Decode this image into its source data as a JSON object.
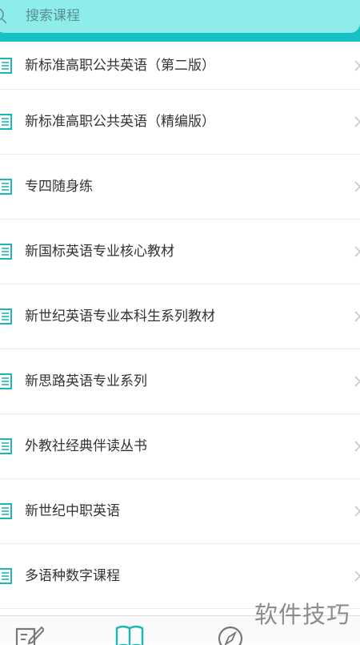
{
  "search": {
    "placeholder": "搜索课程",
    "icon": "search-icon"
  },
  "courses": [
    {
      "title": "新标准高职公共英语（第二版）"
    },
    {
      "title": "新标准高职公共英语（精编版）"
    },
    {
      "title": "专四随身练"
    },
    {
      "title": "新国标英语专业核心教材"
    },
    {
      "title": "新世纪英语专业本科生系列教材"
    },
    {
      "title": "新思路英语专业系列"
    },
    {
      "title": "外教社经典伴读丛书"
    },
    {
      "title": "新世纪中职英语"
    },
    {
      "title": "多语种数字课程"
    }
  ],
  "tabbar": {
    "tabs": [
      {
        "icon": "edit-icon"
      },
      {
        "icon": "book-open-icon"
      },
      {
        "icon": "compass-icon"
      }
    ]
  },
  "watermark": "软件技巧",
  "colors": {
    "header": "#16c1c3",
    "search_background": "#8eecea",
    "accent": "#1db6b6"
  }
}
